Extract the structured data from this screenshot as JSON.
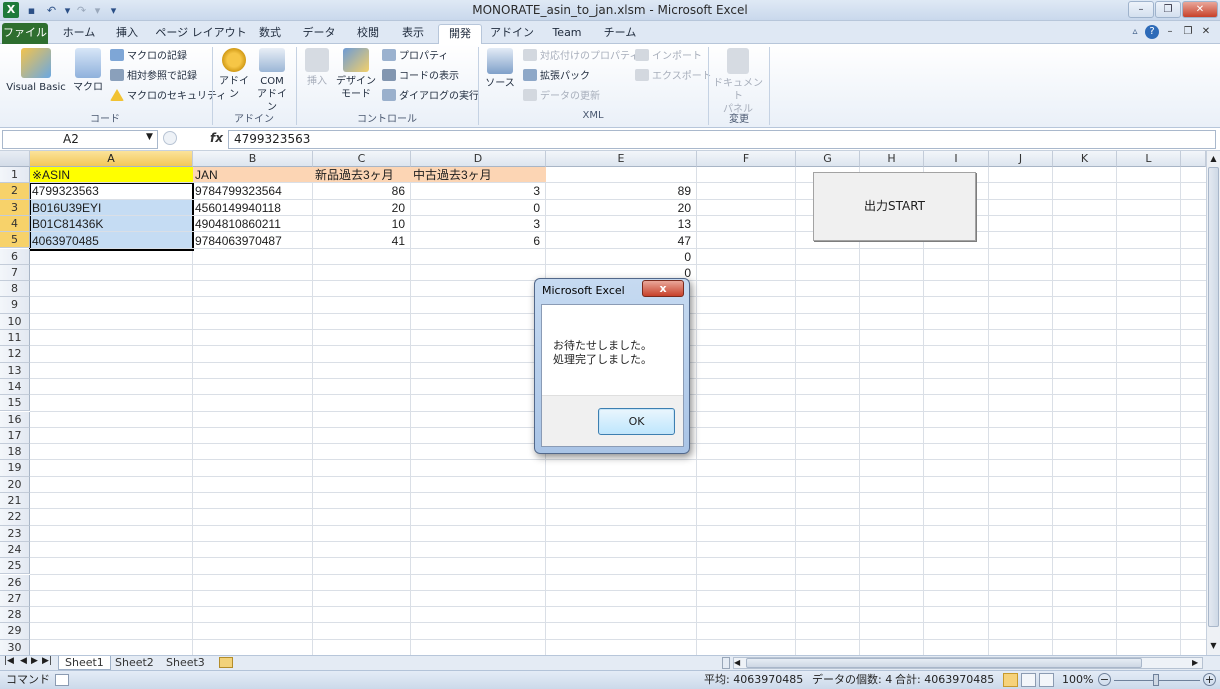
{
  "window": {
    "title": "MONORATE_asin_to_jan.xlsm - Microsoft Excel",
    "app_icon": "X"
  },
  "ribbon_tabs": [
    "ファイル",
    "ホーム",
    "挿入",
    "ページ レイアウト",
    "数式",
    "データ",
    "校閲",
    "表示",
    "開発",
    "アドイン",
    "Team",
    "チーム"
  ],
  "active_tab": "開発",
  "ribbon": {
    "code": {
      "label": "コード",
      "visual_basic": "Visual Basic",
      "macro": "マクロ",
      "record_macro": "マクロの記録",
      "relative_ref": "相対参照で記録",
      "macro_security": "マクロのセキュリティ"
    },
    "addins": {
      "label": "アドイン",
      "addin": "アドイン",
      "com_addin_1": "COM",
      "com_addin_2": "アドイン"
    },
    "controls": {
      "label": "コントロール",
      "insert": "挿入",
      "design_mode_1": "デザイン",
      "design_mode_2": "モード",
      "properties": "プロパティ",
      "view_code": "コードの表示",
      "run_dialog": "ダイアログの実行"
    },
    "xml": {
      "label": "XML",
      "source": "ソース",
      "map_properties": "対応付けのプロパティ",
      "expansion_packs": "拡張パック",
      "refresh_data": "データの更新",
      "import": "インポート",
      "export": "エクスポート"
    },
    "modify": {
      "label": "変更",
      "document_panel_1": "ドキュメント",
      "document_panel_2": "パネル"
    }
  },
  "formula_bar": {
    "name_box": "A2",
    "fx": "fx",
    "value": "4799323563"
  },
  "columns": [
    "A",
    "B",
    "C",
    "D",
    "E",
    "F",
    "G",
    "H",
    "I",
    "J",
    "K",
    "L"
  ],
  "rows": [
    "1",
    "2",
    "3",
    "4",
    "5",
    "6",
    "7",
    "8",
    "9",
    "10",
    "11",
    "12",
    "13",
    "14",
    "15",
    "16",
    "17",
    "18",
    "19",
    "20",
    "21",
    "22",
    "23",
    "24",
    "25",
    "26",
    "27",
    "28",
    "29",
    "30"
  ],
  "cells": {
    "A1": "※ASIN",
    "B1": "JAN",
    "C1": "新品過去3ヶ月",
    "D1": "中古過去3ヶ月",
    "A2": "4799323563",
    "B2": "9784799323564",
    "C2": "86",
    "D2": "3",
    "E2": "89",
    "A3": "B016U39EYI",
    "B3": "4560149940118",
    "C3": "20",
    "D3": "0",
    "E3": "20",
    "A4": "B01C81436K",
    "B4": "4904810860211",
    "C4": "10",
    "D4": "3",
    "E4": "13",
    "A5": "4063970485",
    "B5": "9784063970487",
    "C5": "41",
    "D5": "6",
    "E5": "47",
    "E6": "0",
    "E7": "0"
  },
  "sheet_button": "出力START",
  "sheet_tabs": [
    "Sheet1",
    "Sheet2",
    "Sheet3"
  ],
  "active_sheet": "Sheet1",
  "status": {
    "mode": "コマンド",
    "average": "平均: 4063970485",
    "count": "データの個数: 4",
    "sum": "合計: 4063970485",
    "zoom": "100%"
  },
  "dialog": {
    "title": "Microsoft Excel",
    "close": "x",
    "line1": "お待たせしました。",
    "line2": "処理完了しました。",
    "ok": "OK"
  },
  "colors": {
    "header_yellow": "#ffff00",
    "header_peach": "#fcd5b4",
    "selection": "#c5dcf3",
    "file_tab": "#2e6e2f"
  }
}
